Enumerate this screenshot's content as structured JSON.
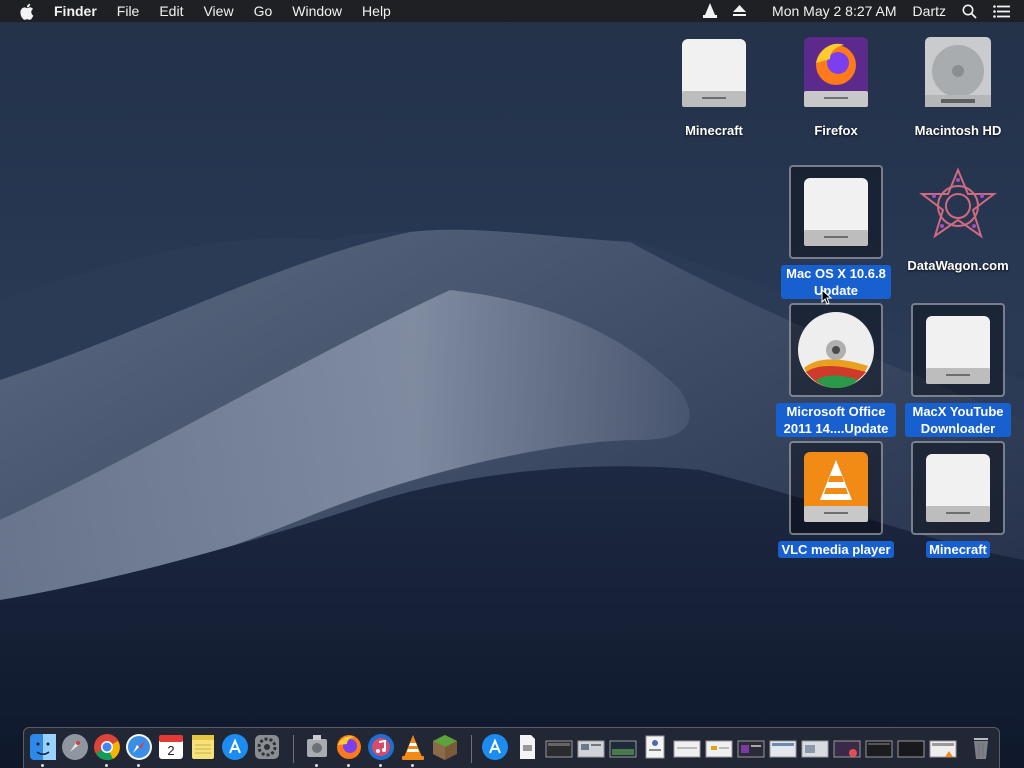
{
  "menubar": {
    "app_name": "Finder",
    "menus": [
      "File",
      "Edit",
      "View",
      "Go",
      "Window",
      "Help"
    ],
    "status_icons": [
      "vlc-status-icon",
      "eject-icon"
    ],
    "clock": "Mon May 2  8:27 AM",
    "user": "Dartz",
    "right_icons": [
      "spotlight-search-icon",
      "notification-center-icon"
    ]
  },
  "desktop_icons": {
    "minecraft_top": "Minecraft",
    "firefox": "Firefox",
    "macintosh_hd": "Macintosh HD",
    "macos_update": "Mac OS X 10.6.8 Update",
    "datawagon": "DataWagon.com",
    "office_update": "Microsoft Office 2011 14....Update",
    "macx_youtube": "MacX YouTube Downloader",
    "vlc": "VLC media player",
    "minecraft_bottom": "Minecraft"
  },
  "colors": {
    "selection_label": "#1860d0",
    "menubar_bg": "#1e1e22",
    "desktop_bg": "#1d2a3f"
  },
  "dock": {
    "apps": [
      "finder-icon",
      "launchpad-icon",
      "chrome-icon",
      "safari-icon",
      "calendar-icon",
      "notes-icon",
      "app-store-icon",
      "system-preferences-icon"
    ],
    "calendar_day": "2",
    "recent": [
      "disk-utility-icon",
      "firefox-icon",
      "itunes-icon",
      "vlc-icon",
      "minecraft-icon"
    ],
    "stacks": [
      "app-store-installer-icon",
      "document-icon",
      "window-thumbnail-icons",
      "trash-icon"
    ]
  }
}
